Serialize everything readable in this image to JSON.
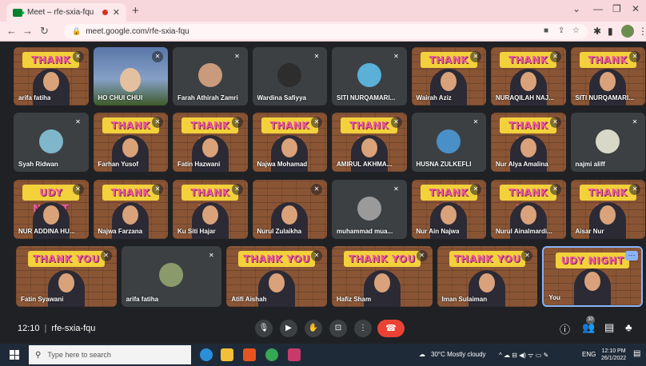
{
  "browser": {
    "tab_title": "Meet – rfe-sxia-fqu",
    "new_tab_symbol": "+",
    "url": "meet.google.com/rfe-sxia-fqu"
  },
  "tiles": [
    {
      "name": "arifa fatiha",
      "type": "thankyou",
      "banner": "THANK YOU"
    },
    {
      "name": "HO CHUI CHUI",
      "type": "photo"
    },
    {
      "name": "Farah Athirah Zamri",
      "type": "avatar",
      "avatar_color": "#c99a7c"
    },
    {
      "name": "Wardina Safiyya",
      "type": "avatar",
      "avatar_color": "#2d2d2d"
    },
    {
      "name": "SITI NURQAMARI...",
      "type": "avatar",
      "avatar_color": "#5ab0d6"
    },
    {
      "name": "Wairah Aziz",
      "type": "thankyou",
      "banner": "THANK YOU"
    },
    {
      "name": "NURAQILAH NAJ...",
      "type": "thankyou",
      "banner": "THANK YOU"
    },
    {
      "name": "SITI NURQAMARI...",
      "type": "thankyou",
      "banner": "THANK YOU"
    },
    {
      "name": "Syah Ridwan",
      "type": "avatar",
      "avatar_color": "#7fb6c9"
    },
    {
      "name": "Farhan Yusof",
      "type": "thankyou",
      "banner": "THANK YOU"
    },
    {
      "name": "Fatin Hazwani",
      "type": "thankyou",
      "banner": "THANK YOU"
    },
    {
      "name": "Najwa Mohamad",
      "type": "thankyou",
      "banner": "THANK YOU"
    },
    {
      "name": "AMIRUL AKHMA...",
      "type": "thankyou",
      "banner": "THANK YOU"
    },
    {
      "name": "HUSNA ZULKEFLI",
      "type": "avatar",
      "avatar_color": "#4a90c8"
    },
    {
      "name": "Nur Alya Amalina",
      "type": "thankyou",
      "banner": "THANK YOU"
    },
    {
      "name": "najmi aliff",
      "type": "avatar",
      "avatar_color": "#d8d8c8"
    },
    {
      "name": "NUR ADDINA HU...",
      "type": "thankyou",
      "banner": "UDY NIGHT"
    },
    {
      "name": "Najwa Farzana",
      "type": "thankyou",
      "banner": "THANK YOU"
    },
    {
      "name": "Ku Siti Hajar",
      "type": "thankyou",
      "banner": "THANK YOU"
    },
    {
      "name": "Nurul Zulaikha",
      "type": "thankyou",
      "banner": ""
    },
    {
      "name": "muhammad mua...",
      "type": "avatar",
      "avatar_color": "#9a9a9a"
    },
    {
      "name": "Nur Ain Najwa",
      "type": "thankyou",
      "banner": "THANK YOU"
    },
    {
      "name": "Nurul Ainalmardi...",
      "type": "thankyou",
      "banner": "THANK YOU"
    },
    {
      "name": "Aisar Nur",
      "type": "thankyou",
      "banner": "THANK YOU"
    },
    {
      "name": "Fatin Syawani",
      "type": "thankyou",
      "banner": "THANK YOU"
    },
    {
      "name": "arifa fatiha",
      "type": "avatar",
      "avatar_color": "#8a9a6a"
    },
    {
      "name": "Atifi Aishah",
      "type": "thankyou",
      "banner": "THANK YOU"
    },
    {
      "name": "Hafiz Sham",
      "type": "thankyou",
      "banner": "THANK YOU"
    },
    {
      "name": "Iman Sulaiman",
      "type": "thankyou",
      "banner": "THANK YOU"
    },
    {
      "name": "You",
      "type": "self",
      "banner": "UDY NIGHT"
    }
  ],
  "bottombar": {
    "time": "12:10",
    "meeting_code": "rfe-sxia-fqu",
    "participants_count": "30"
  },
  "taskbar": {
    "search_placeholder": "Type here to search",
    "weather": "30°C  Mostly cloudy",
    "language": "ENG",
    "clock_time": "12:10 PM",
    "clock_date": "26/1/2022"
  }
}
